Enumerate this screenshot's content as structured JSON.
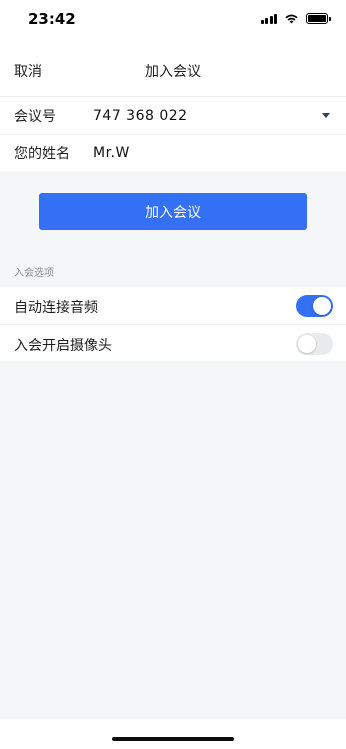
{
  "status_bar": {
    "time": "23:42"
  },
  "nav": {
    "cancel": "取消",
    "title": "加入会议"
  },
  "form": {
    "meeting_id": {
      "label": "会议号",
      "value": "747 368 022"
    },
    "name": {
      "label": "您的姓名",
      "value": "Mr.W"
    }
  },
  "join_button": {
    "label": "加入会议"
  },
  "options": {
    "section_title": "入会选项",
    "items": [
      {
        "label": "自动连接音频",
        "enabled": true
      },
      {
        "label": "入会开启摄像头",
        "enabled": false
      }
    ]
  },
  "colors": {
    "accent": "#3370f4",
    "background": "#f5f6f8"
  }
}
